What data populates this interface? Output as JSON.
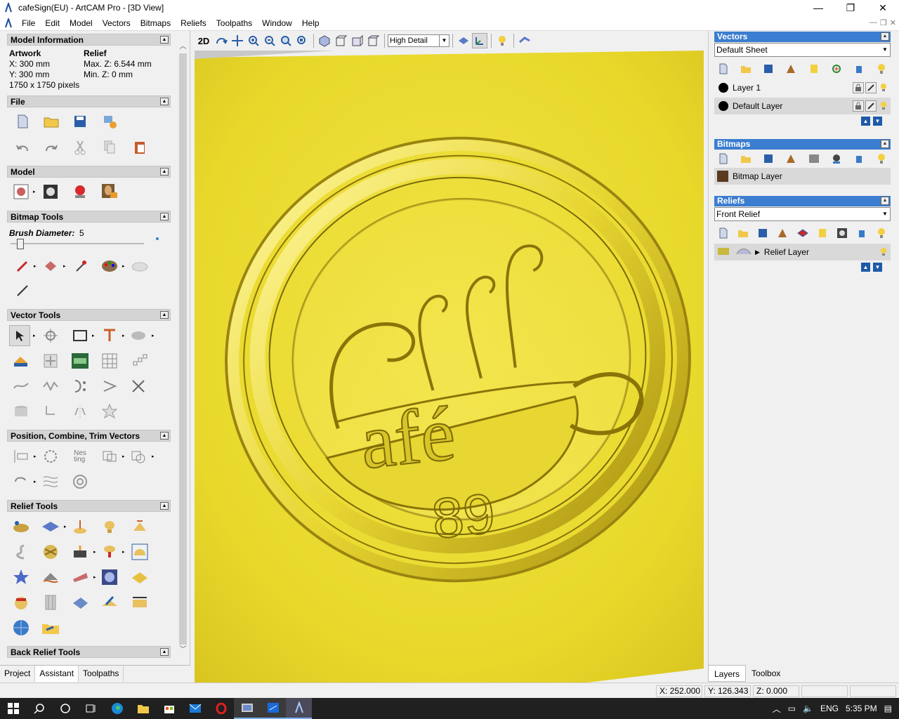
{
  "window": {
    "title": "cafeSign(EU) - ArtCAM Pro - [3D View]",
    "minimize": "—",
    "maximize": "❐",
    "close": "✕"
  },
  "menu": [
    "File",
    "Edit",
    "Model",
    "Vectors",
    "Bitmaps",
    "Reliefs",
    "Toolpaths",
    "Window",
    "Help"
  ],
  "model_info": {
    "header": "Model Information",
    "artwork_label": "Artwork",
    "relief_label": "Relief",
    "x": "X: 300 mm",
    "y": "Y: 300 mm",
    "pixels": "1750 x 1750 pixels",
    "max_z": "Max. Z: 6.544 mm",
    "min_z": "Min. Z: 0 mm"
  },
  "sections": {
    "file": "File",
    "model": "Model",
    "bitmap_tools": "Bitmap Tools",
    "vector_tools": "Vector Tools",
    "position": "Position, Combine, Trim Vectors",
    "relief_tools": "Relief Tools",
    "back_relief": "Back Relief Tools"
  },
  "brush": {
    "label": "Brush Diameter:",
    "value": "5",
    "level": 0.05
  },
  "left_tabs": [
    "Project",
    "Assistant",
    "Toolpaths"
  ],
  "view_toolbar": {
    "mode": "2D",
    "detail": "High Detail"
  },
  "vectors": {
    "header": "Vectors",
    "sheet": "Default Sheet",
    "layers": [
      "Layer 1",
      "Default Layer"
    ]
  },
  "bitmaps": {
    "header": "Bitmaps",
    "layer": "Bitmap Layer"
  },
  "reliefs": {
    "header": "Reliefs",
    "relief": "Front Relief",
    "layer": "Relief Layer"
  },
  "right_tabs": [
    "Layers",
    "Toolbox"
  ],
  "status": {
    "x": "X: 252.000",
    "y": "Y: 126.343",
    "z": "Z: 0.000"
  },
  "taskbar": {
    "lang": "ENG",
    "time": "5:35 PM"
  },
  "colors": {
    "relief": "#e8d82a",
    "header_blue": "#3b7dd0"
  }
}
